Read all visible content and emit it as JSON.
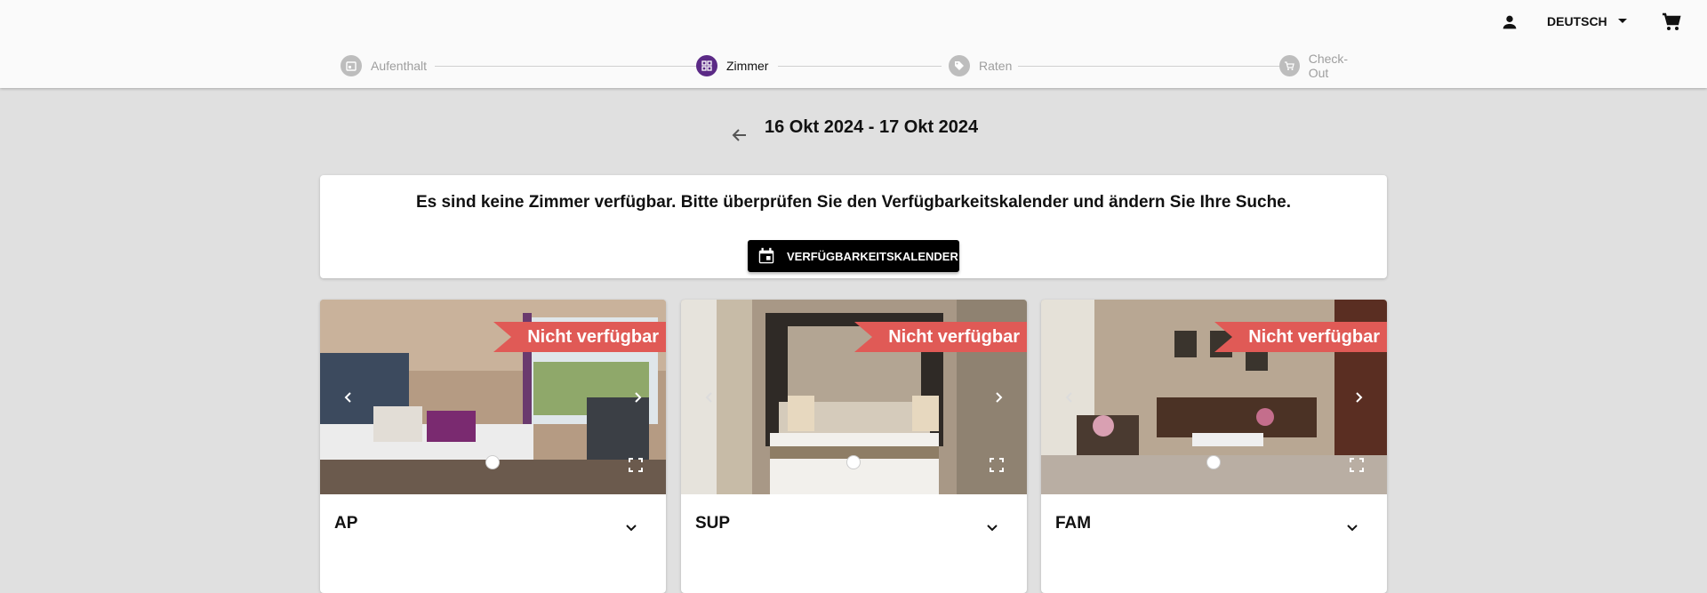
{
  "header": {
    "language": "DEUTSCH",
    "icons": {
      "user": "account-icon",
      "cart": "cart-icon",
      "language_caret": "arrow-drop-down-icon"
    }
  },
  "stepper": {
    "steps": [
      {
        "label": "Aufenthalt",
        "icon": "calendar-icon",
        "state": "inactive"
      },
      {
        "label": "Zimmer",
        "icon": "grid-icon",
        "state": "active"
      },
      {
        "label": "Raten",
        "icon": "tag-icon",
        "state": "inactive"
      },
      {
        "label": "Check-Out",
        "icon": "cart-icon",
        "state": "inactive"
      }
    ]
  },
  "date_range": "16 Okt 2024 - 17 Okt 2024",
  "notice": {
    "message": "Es sind keine Zimmer verfügbar. Bitte überprüfen Sie den Verfügbarkeitskalender und ändern Sie Ihre Suche.",
    "button_label": "VERFÜGBARKEITSKALENDER"
  },
  "rooms": [
    {
      "name": "AP",
      "badge": "Nicht verfügbar",
      "photo": "bedroom with purple pillows and balcony"
    },
    {
      "name": "SUP",
      "badge": "Nicht verfügbar",
      "photo": "bedroom with tufted headboard"
    },
    {
      "name": "FAM",
      "badge": "Nicht verfügbar",
      "photo": "living room with sofas"
    }
  ],
  "colors": {
    "accent": "#5b2a86",
    "badge": "#e05a56",
    "page_bg": "#e0e0e0",
    "button_bg": "#000000"
  }
}
